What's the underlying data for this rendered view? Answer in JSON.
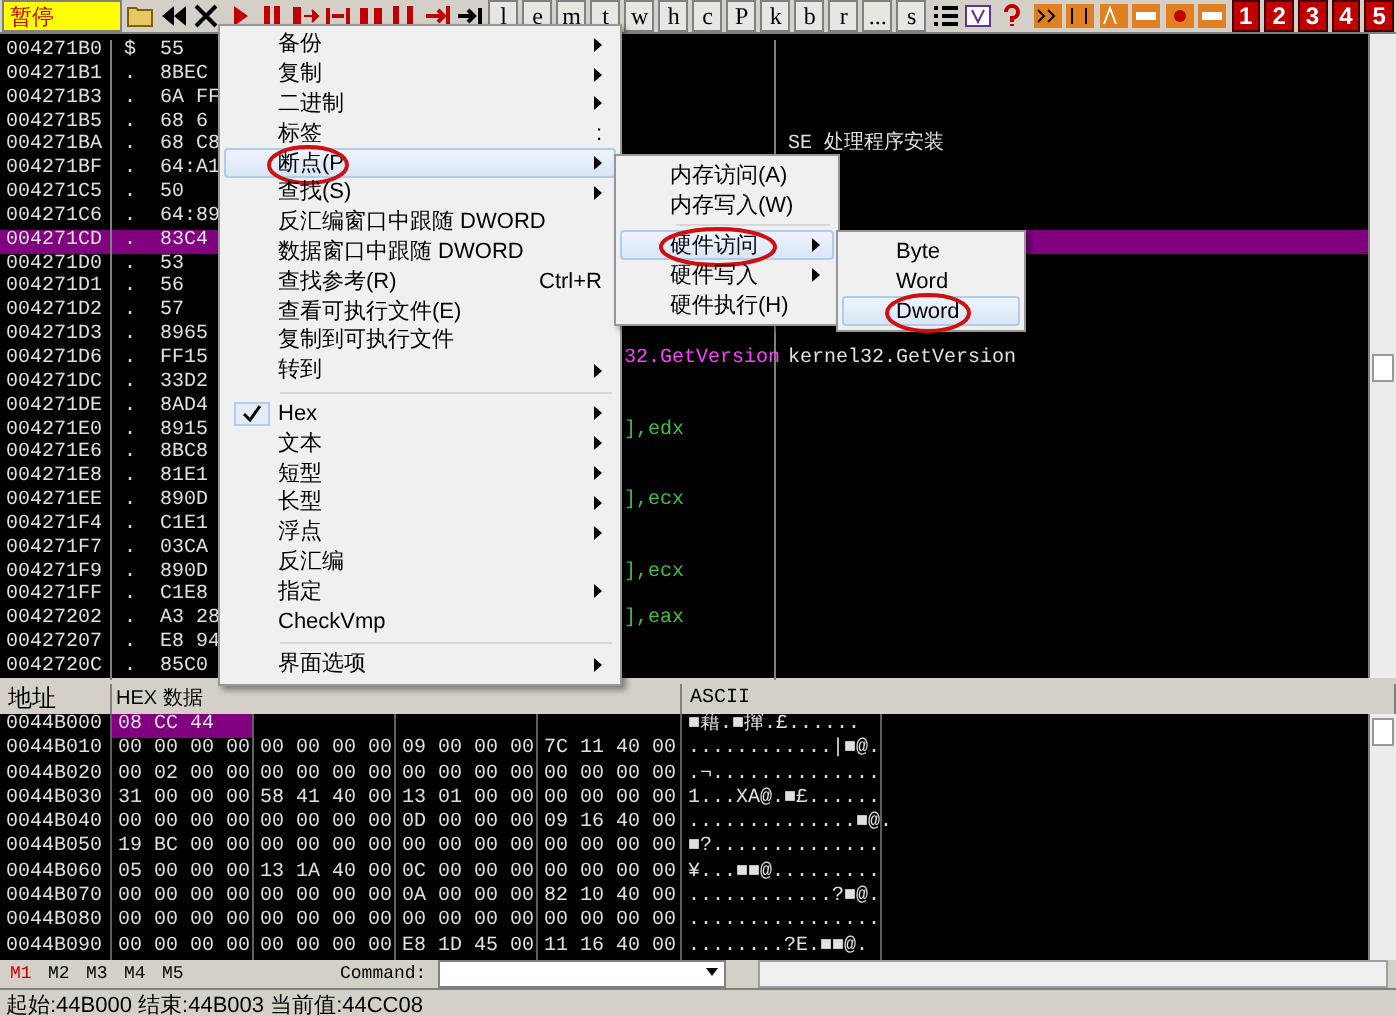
{
  "toolbar": {
    "status": "暂停",
    "letters": [
      "l",
      "e",
      "m",
      "t",
      "w",
      "h",
      "c",
      "P",
      "k",
      "b",
      "r",
      "...",
      "s"
    ],
    "numbers": [
      "1",
      "2",
      "3",
      "4",
      "5"
    ]
  },
  "disasm": {
    "rows": [
      {
        "address": "004271B0",
        "marker": "$",
        "hex": "55",
        "selected": false
      },
      {
        "address": "004271B1",
        "marker": ".",
        "hex": "8BEC",
        "selected": false
      },
      {
        "address": "004271B3",
        "marker": ".",
        "hex": "6A FF",
        "selected": false
      },
      {
        "address": "004271B5",
        "marker": ".",
        "hex": "68 6",
        "selected": false
      },
      {
        "address": "004271BA",
        "marker": ".",
        "hex": "68 C8",
        "selected": false,
        "comment": "SE 处理程序安装"
      },
      {
        "address": "004271BF",
        "marker": ".",
        "hex": "64:A1",
        "selected": false
      },
      {
        "address": "004271C5",
        "marker": ".",
        "hex": "50",
        "selected": false
      },
      {
        "address": "004271C6",
        "marker": ".",
        "hex": "64:89",
        "selected": false
      },
      {
        "address": "004271CD",
        "marker": ".",
        "hex": "83C4",
        "selected": true
      },
      {
        "address": "004271D0",
        "marker": ".",
        "hex": "53",
        "selected": false
      },
      {
        "address": "004271D1",
        "marker": ".",
        "hex": "56",
        "selected": false
      },
      {
        "address": "004271D2",
        "marker": ".",
        "hex": "57",
        "selected": false
      },
      {
        "address": "004271D3",
        "marker": ".",
        "hex": "8965",
        "selected": false
      },
      {
        "address": "004271D6",
        "marker": ".",
        "hex": "FF15",
        "selected": false,
        "code": "32.GetVersion",
        "color": "#ff40ff",
        "comment": "kernel32.GetVersion"
      },
      {
        "address": "004271DC",
        "marker": ".",
        "hex": "33D2",
        "selected": false
      },
      {
        "address": "004271DE",
        "marker": ".",
        "hex": "8AD4",
        "selected": false
      },
      {
        "address": "004271E0",
        "marker": ".",
        "hex": "8915",
        "selected": false,
        "code": "],edx",
        "color": "#40c040"
      },
      {
        "address": "004271E6",
        "marker": ".",
        "hex": "8BC8",
        "selected": false
      },
      {
        "address": "004271E8",
        "marker": ".",
        "hex": "81E1",
        "selected": false
      },
      {
        "address": "004271EE",
        "marker": ".",
        "hex": "890D",
        "selected": false,
        "code": "],ecx",
        "color": "#40c040"
      },
      {
        "address": "004271F4",
        "marker": ".",
        "hex": "C1E1",
        "selected": false
      },
      {
        "address": "004271F7",
        "marker": ".",
        "hex": "03CA",
        "selected": false
      },
      {
        "address": "004271F9",
        "marker": ".",
        "hex": "890D",
        "selected": false,
        "code": "],ecx",
        "color": "#40c040"
      },
      {
        "address": "004271FF",
        "marker": ".",
        "hex": "C1E8",
        "selected": false
      },
      {
        "address": "00427202",
        "marker": ".",
        "hex": "A3 28",
        "selected": false,
        "code": "],eax",
        "color": "#40c040"
      },
      {
        "address": "00427207",
        "marker": ".",
        "hex": "E8 94",
        "selected": false
      },
      {
        "address": "0042720C",
        "marker": ".",
        "hex": "85C0",
        "selected": false
      }
    ]
  },
  "dump": {
    "columns": [
      "地址",
      "HEX 数据",
      "ASCII"
    ],
    "rows": [
      {
        "address": "0044B000",
        "hex": [
          "08 CC 44"
        ],
        "ascii": "■藉.■撺.£......",
        "selected": true
      },
      {
        "address": "0044B010",
        "hex": [
          "00 00 00 00",
          "00 00 00 00",
          "09 00 00 00",
          "7C 11 40 00"
        ],
        "ascii": "............|■@.",
        "selected": false
      },
      {
        "address": "0044B020",
        "hex": [
          "00 02 00 00",
          "00 00 00 00",
          "00 00 00 00",
          "00 00 00 00"
        ],
        "ascii": ".¬..............",
        "selected": false
      },
      {
        "address": "0044B030",
        "hex": [
          "31 00 00 00",
          "58 41 40 00",
          "13 01 00 00",
          "00 00 00 00"
        ],
        "ascii": "1...XA@.■£......",
        "selected": false
      },
      {
        "address": "0044B040",
        "hex": [
          "00 00 00 00",
          "00 00 00 00",
          "0D 00 00 00",
          "09 16 40 00"
        ],
        "ascii": "..............■@.",
        "selected": false
      },
      {
        "address": "0044B050",
        "hex": [
          "19 BC 00 00",
          "00 00 00 00",
          "00 00 00 00",
          "00 00 00 00"
        ],
        "ascii": "■?..............",
        "selected": false
      },
      {
        "address": "0044B060",
        "hex": [
          "05 00 00 00",
          "13 1A 40 00",
          "0C 00 00 00",
          "00 00 00 00"
        ],
        "ascii": "¥...■■@.........",
        "selected": false
      },
      {
        "address": "0044B070",
        "hex": [
          "00 00 00 00",
          "00 00 00 00",
          "0A 00 00 00",
          "82 10 40 00"
        ],
        "ascii": "............?■@.",
        "selected": false
      },
      {
        "address": "0044B080",
        "hex": [
          "00 00 00 00",
          "00 00 00 00",
          "00 00 00 00",
          "00 00 00 00"
        ],
        "ascii": "................",
        "selected": false
      },
      {
        "address": "0044B090",
        "hex": [
          "00 00 00 00",
          "00 00 00 00",
          "E8 1D 45 00",
          "11 16 40 00"
        ],
        "ascii": "........?E.■■@.",
        "selected": false
      }
    ]
  },
  "command_bar": {
    "tabs": [
      {
        "label": "M1",
        "selected": true
      },
      {
        "label": "M2",
        "selected": false
      },
      {
        "label": "M3",
        "selected": false
      },
      {
        "label": "M4",
        "selected": false
      },
      {
        "label": "M5",
        "selected": false
      }
    ],
    "command_label": "Command:"
  },
  "status_bar": "起始:44B000 结束:44B003 当前值:44CC08",
  "context_menu": [
    {
      "kind": "item",
      "label": "备份",
      "submenu": true,
      "checked": false,
      "selected": false,
      "circled": false
    },
    {
      "kind": "item",
      "label": "复制",
      "submenu": true,
      "checked": false,
      "selected": false,
      "circled": false
    },
    {
      "kind": "item",
      "label": "二进制",
      "submenu": true,
      "checked": false,
      "selected": false,
      "circled": false
    },
    {
      "kind": "item",
      "label": "标签",
      "shortcut": ":",
      "submenu": false,
      "checked": false,
      "selected": false,
      "circled": false
    },
    {
      "kind": "item",
      "label": "断点(P",
      "submenu": true,
      "checked": false,
      "selected": true,
      "circled": true
    },
    {
      "kind": "item",
      "label": "查找(S)",
      "submenu": true,
      "checked": false,
      "selected": false,
      "circled": false
    },
    {
      "kind": "item",
      "label": "反汇编窗口中跟随 DWORD",
      "submenu": false,
      "checked": false,
      "selected": false,
      "circled": false
    },
    {
      "kind": "item",
      "label": "数据窗口中跟随 DWORD",
      "submenu": false,
      "checked": false,
      "selected": false,
      "circled": false
    },
    {
      "kind": "item",
      "label": "查找参考(R)",
      "shortcut": "Ctrl+R",
      "submenu": false,
      "checked": false,
      "selected": false,
      "circled": false
    },
    {
      "kind": "item",
      "label": "查看可执行文件(E)",
      "submenu": false,
      "checked": false,
      "selected": false,
      "circled": false
    },
    {
      "kind": "item",
      "label": "复制到可执行文件",
      "submenu": false,
      "checked": false,
      "selected": false,
      "circled": false
    },
    {
      "kind": "item",
      "label": "转到",
      "submenu": true,
      "checked": false,
      "selected": false,
      "circled": false
    },
    {
      "kind": "separator"
    },
    {
      "kind": "item",
      "label": "Hex",
      "submenu": true,
      "checked": true,
      "selected": false,
      "circled": false
    },
    {
      "kind": "item",
      "label": "文本",
      "submenu": true,
      "checked": false,
      "selected": false,
      "circled": false
    },
    {
      "kind": "item",
      "label": "短型",
      "submenu": true,
      "checked": false,
      "selected": false,
      "circled": false
    },
    {
      "kind": "item",
      "label": "长型",
      "submenu": true,
      "checked": false,
      "selected": false,
      "circled": false
    },
    {
      "kind": "item",
      "label": "浮点",
      "submenu": true,
      "checked": false,
      "selected": false,
      "circled": false
    },
    {
      "kind": "item",
      "label": "反汇编",
      "submenu": false,
      "checked": false,
      "selected": false,
      "circled": false
    },
    {
      "kind": "item",
      "label": "指定",
      "submenu": true,
      "checked": false,
      "selected": false,
      "circled": false
    },
    {
      "kind": "item",
      "label": "CheckVmp",
      "submenu": false,
      "checked": false,
      "selected": false,
      "circled": false
    },
    {
      "kind": "separator"
    },
    {
      "kind": "item",
      "label": "界面选项",
      "submenu": true,
      "checked": false,
      "selected": false,
      "circled": false
    }
  ],
  "breakpoint_menu": [
    {
      "kind": "item",
      "label": "内存访问(A)",
      "submenu": false,
      "selected": false,
      "circled": false
    },
    {
      "kind": "item",
      "label": "内存写入(W)",
      "submenu": false,
      "selected": false,
      "circled": false
    },
    {
      "kind": "separator"
    },
    {
      "kind": "item",
      "label": "硬件访问",
      "submenu": true,
      "selected": true,
      "circled": true
    },
    {
      "kind": "item",
      "label": "硬件写入",
      "submenu": true,
      "selected": false,
      "circled": false
    },
    {
      "kind": "item",
      "label": "硬件执行(H)",
      "submenu": false,
      "selected": false,
      "circled": false
    }
  ],
  "hardware_access_menu": [
    {
      "kind": "item",
      "label": "Byte",
      "selected": false,
      "circled": false
    },
    {
      "kind": "item",
      "label": "Word",
      "selected": false,
      "circled": false
    },
    {
      "kind": "item",
      "label": "Dword",
      "selected": true,
      "circled": true
    }
  ]
}
